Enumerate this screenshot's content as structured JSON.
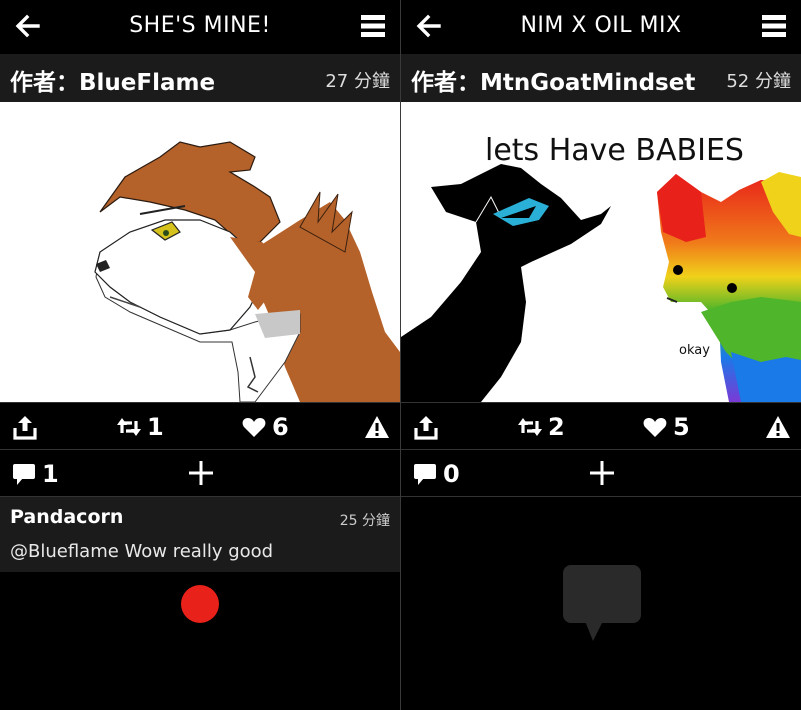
{
  "panels": [
    {
      "title": "SHE'S MINE!",
      "author": "作者：BlueFlame",
      "time": "27 分鐘",
      "reposts": "1",
      "likes": "6",
      "comment_count": "1",
      "comments": [
        {
          "name": "Pandacorn",
          "time": "25 分鐘",
          "text": "@Blueflame Wow really good"
        }
      ]
    },
    {
      "title": "NIM X OIL MIX",
      "author": "作者：MtnGoatMindset",
      "time": "52 分鐘",
      "reposts": "2",
      "likes": "5",
      "comment_count": "0",
      "art_caption": "lets Have BABIES",
      "art_reply": "okay",
      "comments": []
    }
  ],
  "icons": {
    "back": "back-arrow-icon",
    "menu": "hamburger-menu-icon",
    "share": "share-icon",
    "repost": "repost-icon",
    "like": "heart-icon",
    "report": "warning-icon",
    "comment": "comment-bubble-icon",
    "add": "plus-icon"
  },
  "colors": {
    "background": "#000000",
    "bar": "#1b1b1b",
    "accent_red": "#e8211a"
  }
}
